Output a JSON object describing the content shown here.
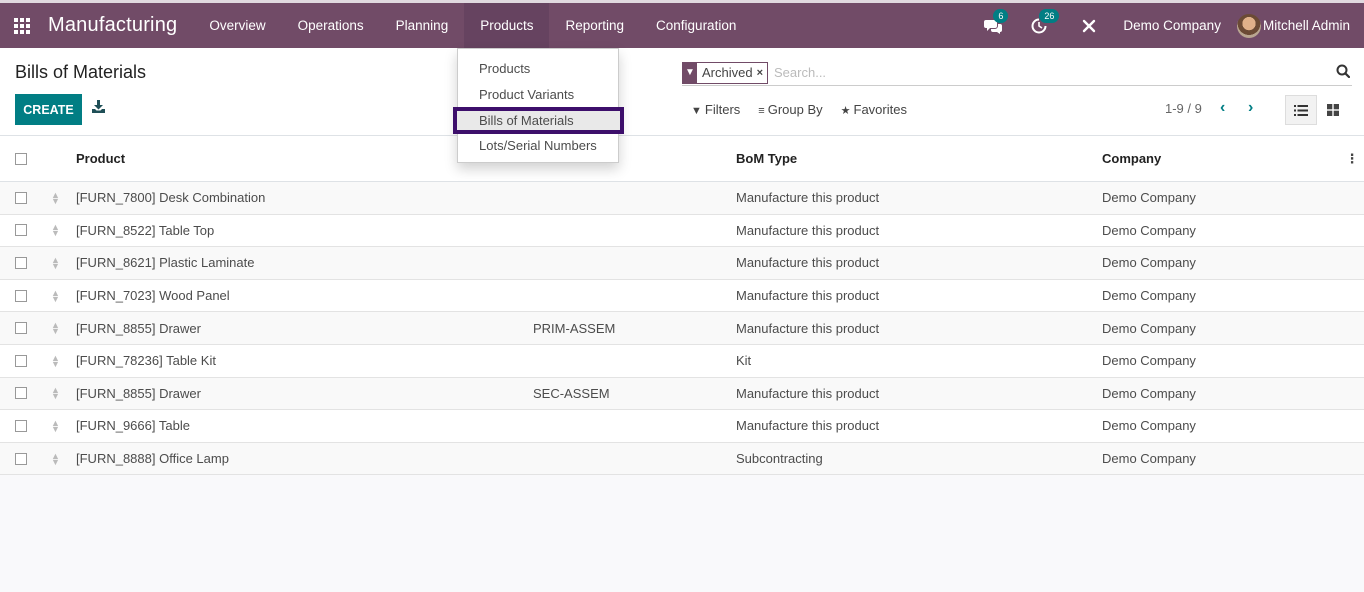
{
  "navbar": {
    "app_name": "Manufacturing",
    "menus": [
      {
        "label": "Overview"
      },
      {
        "label": "Operations"
      },
      {
        "label": "Planning"
      },
      {
        "label": "Products",
        "active": true
      },
      {
        "label": "Reporting"
      },
      {
        "label": "Configuration"
      }
    ],
    "messages_badge": "6",
    "activities_badge": "26",
    "company": "Demo Company",
    "user": "Mitchell Admin"
  },
  "products_menu": {
    "items": [
      {
        "label": "Products"
      },
      {
        "label": "Product Variants"
      },
      {
        "label": "Bills of Materials",
        "highlighted": true
      },
      {
        "label": "Lots/Serial Numbers"
      }
    ]
  },
  "control_panel": {
    "title": "Bills of Materials",
    "create_label": "CREATE",
    "search": {
      "facet": "Archived",
      "placeholder": "Search..."
    },
    "filters_label": "Filters",
    "group_by_label": "Group By",
    "favorites_label": "Favorites",
    "pager": "1-9 / 9"
  },
  "table": {
    "headers": {
      "product": "Product",
      "reference": "",
      "bom_type": "BoM Type",
      "company": "Company"
    },
    "rows": [
      {
        "product": "[FURN_7800] Desk Combination",
        "reference": "",
        "bom_type": "Manufacture this product",
        "company": "Demo Company"
      },
      {
        "product": "[FURN_8522] Table Top",
        "reference": "",
        "bom_type": "Manufacture this product",
        "company": "Demo Company"
      },
      {
        "product": "[FURN_8621] Plastic Laminate",
        "reference": "",
        "bom_type": "Manufacture this product",
        "company": "Demo Company"
      },
      {
        "product": "[FURN_7023] Wood Panel",
        "reference": "",
        "bom_type": "Manufacture this product",
        "company": "Demo Company"
      },
      {
        "product": "[FURN_8855] Drawer",
        "reference": "PRIM-ASSEM",
        "bom_type": "Manufacture this product",
        "company": "Demo Company"
      },
      {
        "product": "[FURN_78236] Table Kit",
        "reference": "",
        "bom_type": "Kit",
        "company": "Demo Company"
      },
      {
        "product": "[FURN_8855] Drawer",
        "reference": "SEC-ASSEM",
        "bom_type": "Manufacture this product",
        "company": "Demo Company"
      },
      {
        "product": "[FURN_9666] Table",
        "reference": "",
        "bom_type": "Manufacture this product",
        "company": "Demo Company"
      },
      {
        "product": "[FURN_8888] Office Lamp",
        "reference": "",
        "bom_type": "Subcontracting",
        "company": "Demo Company"
      }
    ]
  },
  "colors": {
    "brand": "#714b67",
    "accent": "#017e84",
    "highlight_outline": "#3d0f6b"
  }
}
